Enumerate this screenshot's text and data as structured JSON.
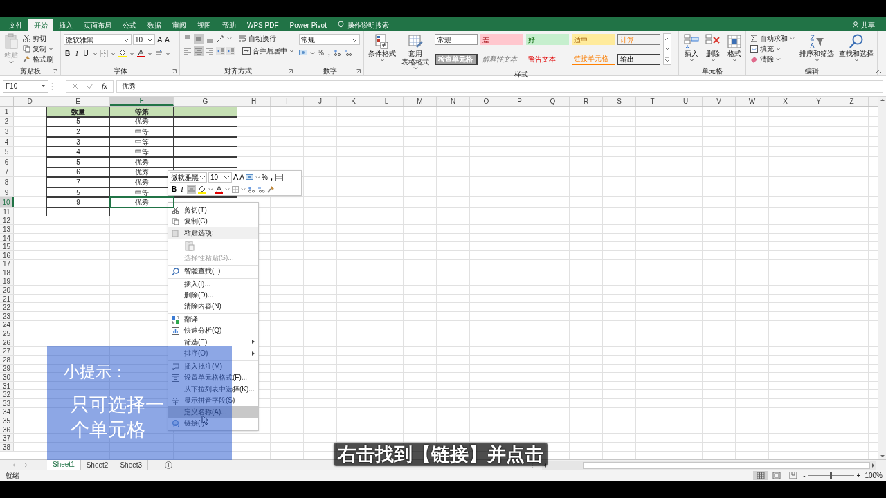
{
  "tabs": [
    {
      "label": "文件",
      "selected": false
    },
    {
      "label": "开始",
      "selected": true
    },
    {
      "label": "插入",
      "selected": false
    },
    {
      "label": "页面布局",
      "selected": false
    },
    {
      "label": "公式",
      "selected": false
    },
    {
      "label": "数据",
      "selected": false
    },
    {
      "label": "审阅",
      "selected": false
    },
    {
      "label": "视图",
      "selected": false
    },
    {
      "label": "帮助",
      "selected": false
    },
    {
      "label": "WPS PDF",
      "selected": false
    },
    {
      "label": "Power Pivot",
      "selected": false
    }
  ],
  "tell_me": "操作说明搜索",
  "share": "共享",
  "ribbon": {
    "clipboard": {
      "label": "剪贴板",
      "paste": "粘贴",
      "cut": "剪切",
      "copy": "复制",
      "format_painter": "格式刷"
    },
    "font": {
      "label": "字体",
      "font_name": "微软雅黑",
      "font_size": "10",
      "grow": "A",
      "shrink": "A",
      "bold": "B",
      "italic": "I",
      "underline": "U"
    },
    "alignment": {
      "label": "对齐方式",
      "vertical": [
        {
          "selected": false
        },
        {
          "selected": true
        },
        {
          "selected": false
        }
      ],
      "horizontal": [
        {
          "selected": false
        },
        {
          "selected": true
        },
        {
          "selected": false
        }
      ],
      "wrap_text": "自动换行",
      "merge_center": "合并后居中"
    },
    "number": {
      "label": "数字",
      "format": "常规",
      "percent": "%",
      "comma": ","
    },
    "styles": {
      "label": "样式",
      "conditional_formatting": "条件格式",
      "format_as_table": [
        "套用",
        "表格格式"
      ],
      "cell_styles": [
        {
          "label": "常规",
          "kind": "normal"
        },
        {
          "label": "差",
          "kind": "bad"
        },
        {
          "label": "好",
          "kind": "good"
        },
        {
          "label": "适中",
          "kind": "neutral"
        },
        {
          "label": "计算",
          "kind": "calculation"
        },
        {
          "label": "检查单元格",
          "kind": "check"
        },
        {
          "label": "解释性文本",
          "kind": "explanatory"
        },
        {
          "label": "警告文本",
          "kind": "warning"
        },
        {
          "label": "链接单元格",
          "kind": "linked"
        },
        {
          "label": "输出",
          "kind": "output"
        }
      ]
    },
    "cells": {
      "label": "单元格",
      "buttons": [
        "插入",
        "删除",
        "格式"
      ]
    },
    "editing": {
      "label": "编辑",
      "autosum": "自动求和",
      "fill": "填充",
      "clear": "清除",
      "sort_filter": "排序和筛选",
      "find_select": "查找和选择"
    }
  },
  "formula_bar": {
    "name_box": "F10",
    "function_label": "fx",
    "formula": "优秀"
  },
  "columns": [
    {
      "label": "D",
      "selected": false
    },
    {
      "label": "E",
      "selected": false
    },
    {
      "label": "F",
      "selected": true
    },
    {
      "label": "G",
      "selected": false
    },
    {
      "label": "H",
      "selected": false
    },
    {
      "label": "I",
      "selected": false
    },
    {
      "label": "J",
      "selected": false
    },
    {
      "label": "K",
      "selected": false
    },
    {
      "label": "L",
      "selected": false
    },
    {
      "label": "M",
      "selected": false
    },
    {
      "label": "N",
      "selected": false
    },
    {
      "label": "O",
      "selected": false
    },
    {
      "label": "P",
      "selected": false
    },
    {
      "label": "Q",
      "selected": false
    },
    {
      "label": "R",
      "selected": false
    },
    {
      "label": "S",
      "selected": false
    },
    {
      "label": "T",
      "selected": false
    },
    {
      "label": "U",
      "selected": false
    },
    {
      "label": "V",
      "selected": false
    },
    {
      "label": "W",
      "selected": false
    },
    {
      "label": "X",
      "selected": false
    },
    {
      "label": "Y",
      "selected": false
    },
    {
      "label": "Z",
      "selected": false
    }
  ],
  "rows": [
    {
      "label": "1",
      "selected": false
    },
    {
      "label": "2",
      "selected": false
    },
    {
      "label": "3",
      "selected": false
    },
    {
      "label": "4",
      "selected": false
    },
    {
      "label": "5",
      "selected": false
    },
    {
      "label": "6",
      "selected": false
    },
    {
      "label": "7",
      "selected": false
    },
    {
      "label": "8",
      "selected": false
    },
    {
      "label": "9",
      "selected": false
    },
    {
      "label": "10",
      "selected": true
    },
    {
      "label": "11",
      "selected": false
    },
    {
      "label": "12",
      "selected": false
    },
    {
      "label": "13",
      "selected": false
    },
    {
      "label": "14",
      "selected": false
    },
    {
      "label": "15",
      "selected": false
    },
    {
      "label": "16",
      "selected": false
    },
    {
      "label": "17",
      "selected": false
    },
    {
      "label": "18",
      "selected": false
    },
    {
      "label": "19",
      "selected": false
    },
    {
      "label": "20",
      "selected": false
    },
    {
      "label": "21",
      "selected": false
    },
    {
      "label": "22",
      "selected": false
    },
    {
      "label": "23",
      "selected": false
    },
    {
      "label": "24",
      "selected": false
    },
    {
      "label": "25",
      "selected": false
    },
    {
      "label": "26",
      "selected": false
    },
    {
      "label": "27",
      "selected": false
    },
    {
      "label": "28",
      "selected": false
    },
    {
      "label": "29",
      "selected": false
    },
    {
      "label": "30",
      "selected": false
    },
    {
      "label": "31",
      "selected": false
    },
    {
      "label": "32",
      "selected": false
    },
    {
      "label": "33",
      "selected": false
    },
    {
      "label": "34",
      "selected": false
    },
    {
      "label": "35",
      "selected": false
    },
    {
      "label": "36",
      "selected": false
    },
    {
      "label": "37",
      "selected": false
    },
    {
      "label": "38",
      "selected": false
    }
  ],
  "table": {
    "header": [
      "数量",
      "等第"
    ],
    "rows": [
      {
        "values": [
          "5",
          "优秀"
        ],
        "selected": false
      },
      {
        "values": [
          "2",
          "中等"
        ],
        "selected": false
      },
      {
        "values": [
          "3",
          "中等"
        ],
        "selected": false
      },
      {
        "values": [
          "4",
          "中等"
        ],
        "selected": false
      },
      {
        "values": [
          "5",
          "优秀"
        ],
        "selected": false
      },
      {
        "values": [
          "6",
          "优秀"
        ],
        "selected": false
      },
      {
        "values": [
          "7",
          "优秀"
        ],
        "selected": false
      },
      {
        "values": [
          "5",
          "中等"
        ],
        "selected": false
      },
      {
        "values": [
          "9",
          "优秀"
        ],
        "selected": true
      }
    ]
  },
  "mini_toolbar": {
    "font_name": "微软雅黑",
    "font_size": "10",
    "grow": "A",
    "shrink": "A",
    "percent": "%",
    "comma": ",",
    "bold": "B",
    "italic": "I",
    "center_selected": true
  },
  "context_menu": [
    {
      "label": "剪切(T)",
      "kind": "item",
      "divider_above": false,
      "disabled": false,
      "submenu": false,
      "selected": false
    },
    {
      "label": "复制(C)",
      "kind": "item",
      "divider_above": false,
      "disabled": false,
      "submenu": false,
      "selected": false
    },
    {
      "label": "粘贴选项:",
      "kind": "header",
      "divider_above": false,
      "disabled": false,
      "submenu": false,
      "selected": false
    },
    {
      "kind": "paste_options",
      "divider_above": false,
      "disabled": false,
      "submenu": false,
      "selected": false
    },
    {
      "label": "选择性粘贴(S)...",
      "kind": "item",
      "divider_above": false,
      "disabled": true,
      "submenu": false,
      "selected": false
    },
    {
      "label": "智能查找(L)",
      "kind": "item",
      "divider_above": true,
      "disabled": false,
      "submenu": false,
      "selected": false
    },
    {
      "label": "插入(I)...",
      "kind": "item",
      "divider_above": true,
      "disabled": false,
      "submenu": false,
      "selected": false
    },
    {
      "label": "删除(D)...",
      "kind": "item",
      "divider_above": false,
      "disabled": false,
      "submenu": false,
      "selected": false
    },
    {
      "label": "清除内容(N)",
      "kind": "item",
      "divider_above": false,
      "disabled": false,
      "submenu": false,
      "selected": false
    },
    {
      "label": "翻译",
      "kind": "item",
      "divider_above": true,
      "disabled": false,
      "submenu": false,
      "selected": false
    },
    {
      "label": "快速分析(Q)",
      "kind": "item",
      "divider_above": false,
      "disabled": false,
      "submenu": false,
      "selected": false
    },
    {
      "label": "筛选(E)",
      "kind": "item",
      "divider_above": false,
      "disabled": false,
      "submenu": true,
      "selected": false
    },
    {
      "label": "排序(O)",
      "kind": "item",
      "divider_above": false,
      "disabled": false,
      "submenu": true,
      "selected": false
    },
    {
      "label": "插入批注(M)",
      "kind": "item",
      "divider_above": true,
      "disabled": false,
      "submenu": false,
      "selected": false
    },
    {
      "label": "设置单元格格式(F)...",
      "kind": "item",
      "divider_above": false,
      "disabled": false,
      "submenu": false,
      "selected": false
    },
    {
      "label": "从下拉列表中选择(K)...",
      "kind": "item",
      "divider_above": false,
      "disabled": false,
      "submenu": false,
      "selected": false
    },
    {
      "label": "显示拼音字段(S)",
      "kind": "item",
      "divider_above": false,
      "disabled": false,
      "submenu": false,
      "selected": false
    },
    {
      "label": "定义名称(A)...",
      "kind": "item",
      "divider_above": false,
      "disabled": false,
      "submenu": false,
      "selected": true
    },
    {
      "label": "链接(I)",
      "kind": "item",
      "divider_above": false,
      "disabled": false,
      "submenu": false,
      "selected": false
    }
  ],
  "sheets": [
    {
      "label": "Sheet1",
      "selected": true
    },
    {
      "label": "Sheet2",
      "selected": false
    },
    {
      "label": "Sheet3",
      "selected": false
    }
  ],
  "status_bar": {
    "status": "就绪",
    "zoom_out": "-",
    "zoom_slider": {
      "level": 0.5
    },
    "zoom_in": "+",
    "zoom": "100%"
  },
  "tip": {
    "title": "小提示：",
    "body": "只可选择一个单元格"
  },
  "subtitle": "右击找到【链接】并点击"
}
